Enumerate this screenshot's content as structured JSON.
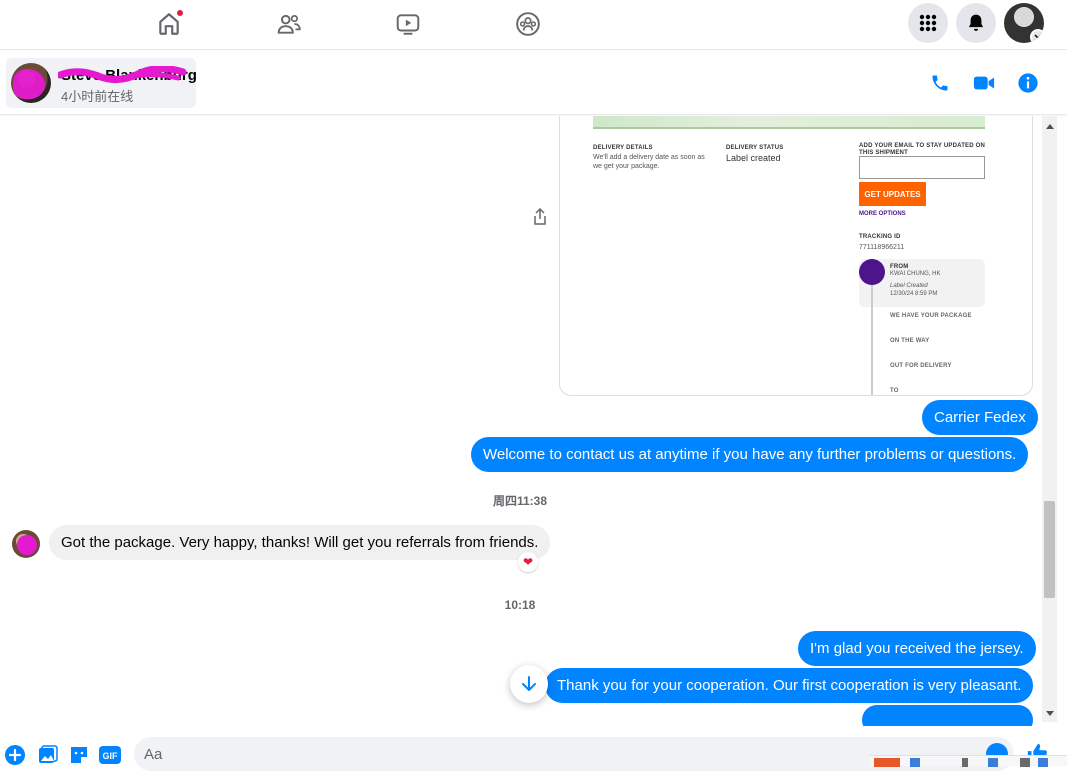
{
  "topnav": {
    "items": [
      {
        "name": "home",
        "icon": "home-icon",
        "has_notification": true
      },
      {
        "name": "friends",
        "icon": "friends-icon"
      },
      {
        "name": "watch",
        "icon": "video-icon"
      },
      {
        "name": "groups",
        "icon": "groups-icon"
      }
    ],
    "right": [
      "menu-grid-icon",
      "bell-icon",
      "profile-avatar"
    ]
  },
  "chat_header": {
    "contact_name": "Steve Blankenburg",
    "status": "4小时前在线",
    "actions": [
      "phone-icon",
      "video-call-icon",
      "info-icon"
    ]
  },
  "shipment_card": {
    "delivery_details_label": "DELIVERY DETAILS",
    "delivery_details_text_1": "We'll add a delivery date as soon as",
    "delivery_details_text_2": "we get your package.",
    "delivery_status_label": "DELIVERY STATUS",
    "delivery_status_value": "Label created",
    "email_label_1": "ADD YOUR EMAIL TO STAY UPDATED ON",
    "email_label_2": "THIS SHIPMENT",
    "get_updates": "GET UPDATES",
    "more_options": "MORE OPTIONS",
    "tracking_id_label": "TRACKING ID",
    "tracking_id": "771118966211",
    "from_label": "FROM",
    "from_value": "KWAI CHUNG, HK",
    "from_status": "Label Created",
    "from_date": "12/30/24 8:59 PM",
    "step_1": "WE HAVE YOUR PACKAGE",
    "step_2": "ON THE WAY",
    "step_3": "OUT FOR DELIVERY",
    "step_4": "TO"
  },
  "messages": {
    "m1": "Carrier Fedex",
    "m2": "Welcome to contact us at anytime if you have any further problems or questions.",
    "ts1": "周四11:38",
    "m3": "Got the package. Very happy, thanks! Will get you referrals from friends.",
    "ts2": "10:18",
    "m4": "I'm glad you received the jersey.",
    "m5": "Thank you for your cooperation. Our first cooperation is very pleasant."
  },
  "composer": {
    "placeholder": "Aa",
    "gif_label": "GIF"
  },
  "colors": {
    "accent": "#0084ff",
    "fedex_orange": "#ff6200",
    "fedex_purple": "#4d148c"
  }
}
